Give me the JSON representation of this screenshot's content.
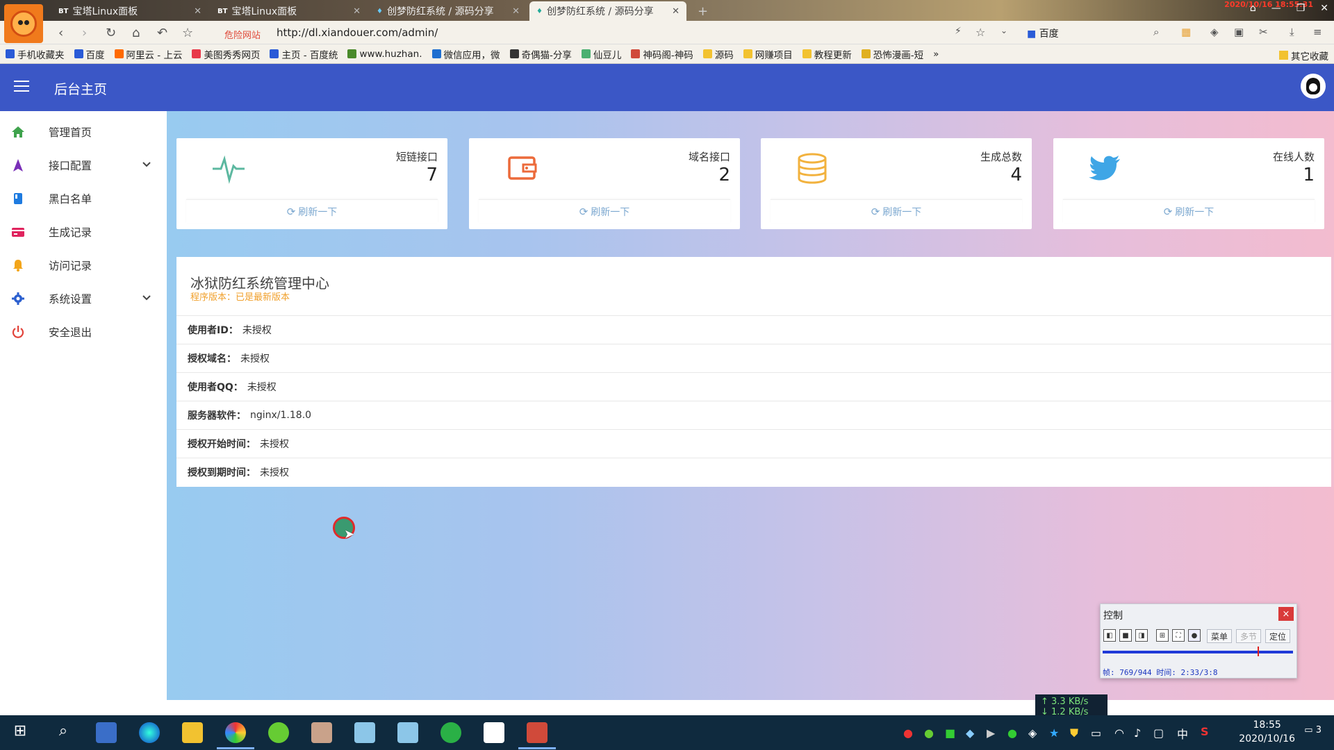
{
  "browser": {
    "tabs": [
      {
        "icon": "BT",
        "title": "宝塔Linux面板"
      },
      {
        "icon": "BT",
        "title": "宝塔Linux面板"
      },
      {
        "icon": "♦",
        "title": "创梦防红系统 / 源码分享"
      },
      {
        "icon": "♦",
        "title": "创梦防红系统 / 源码分享"
      }
    ],
    "new_tab": "+",
    "clock_overlay": "2020/10/16 18:55:31",
    "danger_label": "危险网站",
    "url": "http://dl.xiandouer.com/admin/",
    "search_engine": "百度",
    "bookmarks": [
      "手机收藏夹",
      "百度",
      "阿里云 - 上云",
      "美图秀秀网页",
      "主页 - 百度统",
      "www.huzhan.",
      "微信应用，微",
      "奇偶猫-分享",
      "仙豆儿",
      "神码阁-神码",
      "源码",
      "网赚项目",
      "教程更新",
      "恐怖漫画-短"
    ],
    "bookmarks_more": "»",
    "bookmarks_other": "其它收藏"
  },
  "header": {
    "title": "后台主页"
  },
  "sidebar": {
    "items": [
      {
        "label": "管理首页",
        "icon": "home-icon",
        "color": "#3fa34d",
        "expandable": false
      },
      {
        "label": "接口配置",
        "icon": "navigation-arrow-icon",
        "color": "#7a2fb8",
        "expandable": true
      },
      {
        "label": "黑白名单",
        "icon": "book-icon",
        "color": "#1e7be0",
        "expandable": false
      },
      {
        "label": "生成记录",
        "icon": "card-icon",
        "color": "#e0245e",
        "expandable": false
      },
      {
        "label": "访问记录",
        "icon": "bell-icon",
        "color": "#f3a51a",
        "expandable": false
      },
      {
        "label": "系统设置",
        "icon": "gear-icon",
        "color": "#2b5fcf",
        "expandable": true
      },
      {
        "label": "安全退出",
        "icon": "power-icon",
        "color": "#e2433a",
        "expandable": false
      }
    ]
  },
  "stats": [
    {
      "label": "短链接口",
      "value": "7",
      "icon": "pulse-icon",
      "color": "#5cb8a0",
      "refresh": "刷新一下"
    },
    {
      "label": "域名接口",
      "value": "2",
      "icon": "wallet-icon",
      "color": "#ec6a3a",
      "refresh": "刷新一下"
    },
    {
      "label": "生成总数",
      "value": "4",
      "icon": "database-icon",
      "color": "#f2b23e",
      "refresh": "刷新一下"
    },
    {
      "label": "在线人数",
      "value": "1",
      "icon": "twitter-icon",
      "color": "#3fa6e6",
      "refresh": "刷新一下"
    }
  ],
  "panel": {
    "title": "冰狱防红系统管理中心",
    "version": "程序版本：已是最新版本",
    "rows": [
      {
        "key": "使用者ID：",
        "value": "未授权"
      },
      {
        "key": "授权域名：",
        "value": "未授权"
      },
      {
        "key": "使用者QQ：",
        "value": "未授权"
      },
      {
        "key": "服务器软件：",
        "value": "nginx/1.18.0"
      },
      {
        "key": "授权开始时间：",
        "value": "未授权"
      },
      {
        "key": "授权到期时间：",
        "value": "未授权"
      }
    ]
  },
  "control": {
    "title": "控制",
    "close": "×",
    "menu_label": "菜单",
    "multi_label": "多节",
    "locate_label": "定位",
    "status": "帧: 769/944 时间: 2:33/3:8",
    "progress": 0.815
  },
  "taskbar": {
    "net_up": "↑ 3.3 KB/s",
    "net_down": "↓ 1.2 KB/s",
    "time": "18:55",
    "date": "2020/10/16",
    "notif_count": "3",
    "ime": "中"
  },
  "colors": {
    "header_bg": "#3b57c6",
    "accent_orange": "#f0a02c",
    "refresh_blue": "#7ca8d0"
  }
}
